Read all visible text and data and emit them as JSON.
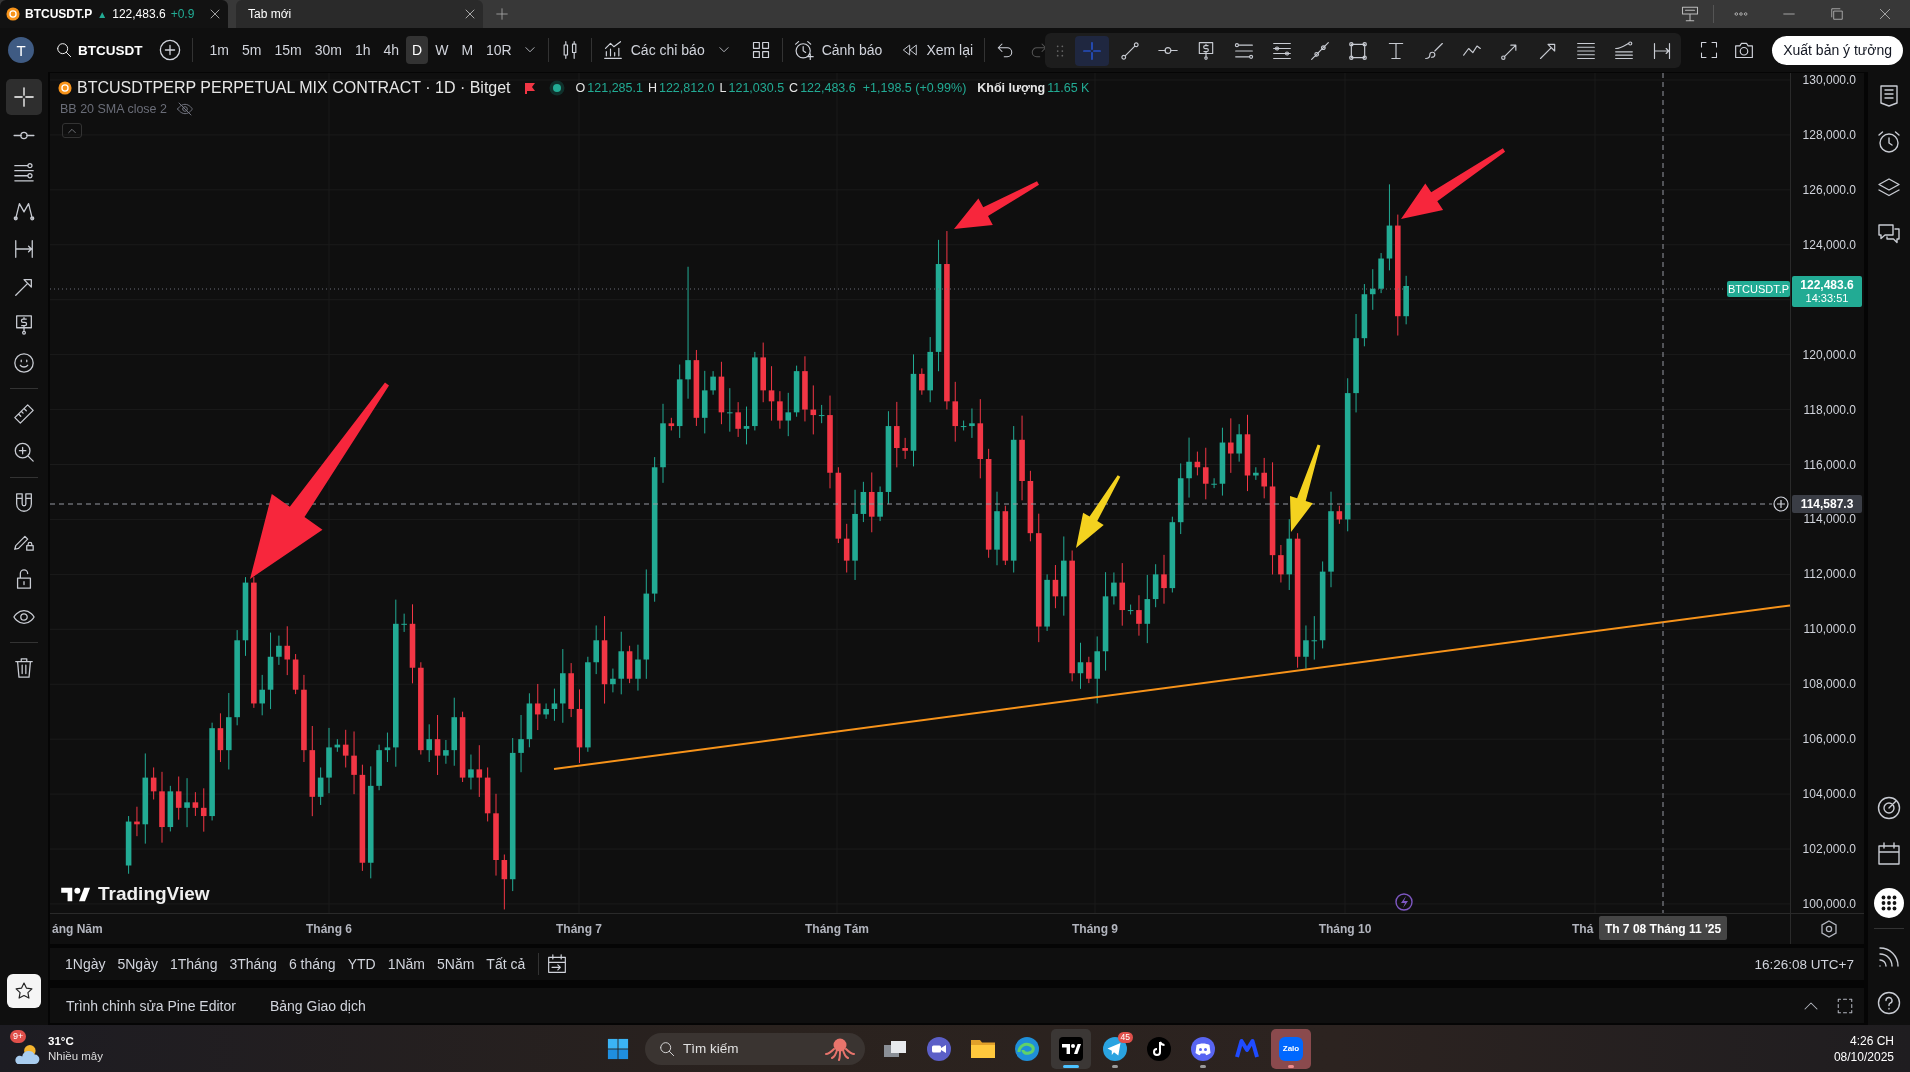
{
  "tabs": [
    {
      "title": "BTCUSDT.P",
      "trend": "▲",
      "price": "122,483.6",
      "change": "+0.9",
      "selected": true
    },
    {
      "title": "Tab mới",
      "selected": false
    }
  ],
  "toolbar": {
    "avatar": "T",
    "symbol": "BTCUSDT",
    "intervals": [
      {
        "label": "1m",
        "selected": false
      },
      {
        "label": "5m",
        "selected": false
      },
      {
        "label": "15m",
        "selected": false
      },
      {
        "label": "30m",
        "selected": false
      },
      {
        "label": "1h",
        "selected": false
      },
      {
        "label": "4h",
        "selected": false
      },
      {
        "label": "D",
        "selected": true
      },
      {
        "label": "W",
        "selected": false
      },
      {
        "label": "M",
        "selected": false
      },
      {
        "label": "10R",
        "selected": false
      }
    ],
    "indicators": "Các chỉ báo",
    "alerts": "Cảnh báo",
    "replay": "Xem lại",
    "publish": "Xuất bản ý tưởng"
  },
  "drawing_toolbar": {
    "tools": [
      {
        "kind": "crosshair",
        "selected": true
      },
      {
        "kind": "line",
        "selected": false
      },
      {
        "kind": "horizontal-ray",
        "selected": false
      },
      {
        "kind": "price-label",
        "selected": false
      },
      {
        "kind": "channel",
        "selected": false
      },
      {
        "kind": "fib-lines",
        "selected": false
      },
      {
        "kind": "ray",
        "selected": false
      },
      {
        "kind": "rectangle",
        "selected": false
      },
      {
        "kind": "text",
        "selected": false
      },
      {
        "kind": "brush",
        "selected": false
      },
      {
        "kind": "path",
        "selected": false
      },
      {
        "kind": "arrow-marker",
        "selected": false
      },
      {
        "kind": "arrow",
        "selected": false
      },
      {
        "kind": "levels",
        "selected": false
      },
      {
        "kind": "curve-levels",
        "selected": false
      },
      {
        "kind": "date-range",
        "selected": false
      }
    ]
  },
  "left_toolbar": {
    "groups": [
      [
        {
          "kind": "crosshair",
          "selected": true
        },
        {
          "kind": "trend-line",
          "selected": false
        },
        {
          "kind": "fib",
          "selected": false
        },
        {
          "kind": "pattern",
          "selected": false
        },
        {
          "kind": "measure",
          "selected": false
        },
        {
          "kind": "arrow",
          "selected": false
        },
        {
          "kind": "price-note",
          "selected": false
        },
        {
          "kind": "emoji",
          "selected": false
        }
      ],
      [
        {
          "kind": "ruler",
          "selected": false
        },
        {
          "kind": "zoom",
          "selected": false
        }
      ],
      [
        {
          "kind": "magnet",
          "selected": false
        },
        {
          "kind": "draw-lock",
          "selected": false
        },
        {
          "kind": "lock",
          "selected": false
        },
        {
          "kind": "eye",
          "selected": false
        }
      ],
      [
        {
          "kind": "trash",
          "selected": false
        }
      ]
    ]
  },
  "legend": {
    "title": "BTCUSDTPERP PERPETUAL MIX CONTRACT · 1D · Bitget",
    "ohlc": [
      {
        "key": "O",
        "value": "121,285.1"
      },
      {
        "key": "H",
        "value": "122,812.0"
      },
      {
        "key": "L",
        "value": "121,030.5"
      },
      {
        "key": "C",
        "value": "122,483.6"
      }
    ],
    "change": "+1,198.5 (+0.99%)",
    "volume_label": "Khối lượng",
    "volume": "11.65 K",
    "indicator": "BB 20 SMA close 2",
    "indicator_hidden": true
  },
  "chart": {
    "price_axis": [
      "130,000.0",
      "128,000.0",
      "126,000.0",
      "124,000.0",
      "120,000.0",
      "118,000.0",
      "116,000.0",
      "114,000.0",
      "112,000.0",
      "110,000.0",
      "108,000.0",
      "106,000.0",
      "104,000.0",
      "102,000.0",
      "100,000.0"
    ],
    "time_axis": [
      "áng Năm",
      "Tháng 6",
      "Tháng 7",
      "Tháng Tám",
      "Tháng 9",
      "Tháng 10",
      "Thá"
    ],
    "last_price": {
      "symbol": "BTCUSDT.P",
      "price": "122,483.6",
      "countdown": "14:33:51"
    },
    "crosshair": {
      "price": "114,587.3",
      "date": "Th 7 08 Tháng 11 '25"
    },
    "brand": "TradingView"
  },
  "range_bar": {
    "ranges": [
      "1Ngày",
      "5Ngày",
      "1Tháng",
      "3Tháng",
      "6 tháng",
      "YTD",
      "1Năm",
      "5Năm",
      "Tất cả"
    ],
    "clock": "16:26:08 UTC+7"
  },
  "bottom_panel": {
    "tabs": [
      "Trình chỉnh sửa Pine Editor",
      "Bảng Giao dịch"
    ]
  },
  "taskbar": {
    "weather": {
      "badge": "9+",
      "temperature": "31°C",
      "condition": "Nhiều mây"
    },
    "search": {
      "placeholder": "Tìm kiếm"
    },
    "apps": [
      {
        "kind": "task-view",
        "running": false,
        "active": false,
        "flashing": false
      },
      {
        "kind": "video-call",
        "running": false,
        "active": false,
        "flashing": false
      },
      {
        "kind": "folder",
        "running": false,
        "active": false,
        "flashing": false
      },
      {
        "kind": "browser",
        "running": false,
        "active": false,
        "flashing": false
      },
      {
        "kind": "chart-app",
        "running": true,
        "active": true,
        "flashing": false
      },
      {
        "kind": "messenger",
        "running": true,
        "active": false,
        "flashing": false,
        "badge": "45"
      },
      {
        "kind": "music-note",
        "running": false,
        "active": false,
        "flashing": false
      },
      {
        "kind": "game-chat",
        "running": true,
        "active": false,
        "flashing": false
      },
      {
        "kind": "m-logo",
        "running": false,
        "active": false,
        "flashing": false
      },
      {
        "kind": "chat-app",
        "running": true,
        "active": false,
        "flashing": true,
        "label": "Zalo"
      }
    ],
    "time": "4:26 CH",
    "date": "08/10/2025"
  }
}
